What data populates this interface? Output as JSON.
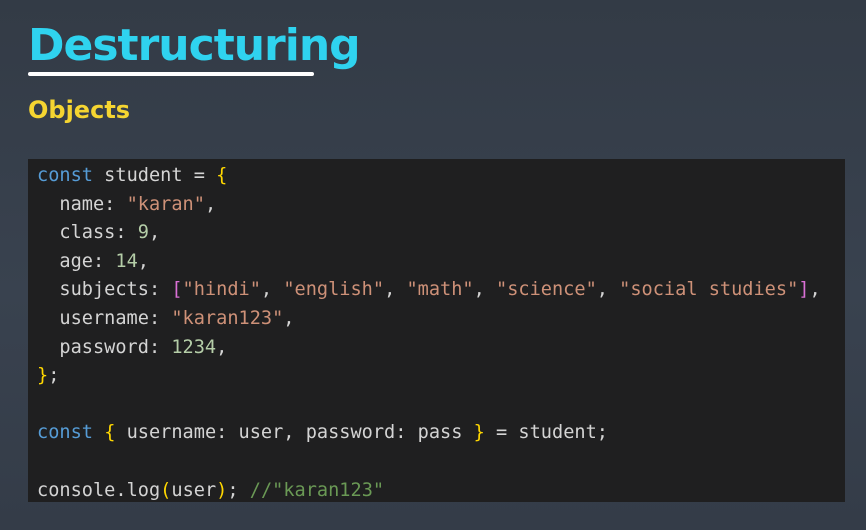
{
  "slide": {
    "title": "Destructuring",
    "subtitle": "Objects"
  },
  "colors": {
    "background": "#363f4b",
    "title": "#2fd3ef",
    "underline": "#ffffff",
    "subtitle": "#f5d531",
    "code_background": "#1f1f20",
    "keyword": "#569cd6",
    "string": "#ce9178",
    "number": "#b5cea8",
    "comment": "#6a9955",
    "bracket_level1": "#ffd700",
    "bracket_level2": "#da70d6"
  },
  "code": {
    "language": "javascript",
    "lines": [
      [
        {
          "t": "kw",
          "v": "const"
        },
        {
          "t": "id",
          "v": " student "
        },
        {
          "t": "pun",
          "v": "= "
        },
        {
          "t": "br1",
          "v": "{"
        }
      ],
      [
        {
          "t": "prop",
          "v": "  name"
        },
        {
          "t": "pun",
          "v": ": "
        },
        {
          "t": "str",
          "v": "\"karan\""
        },
        {
          "t": "pun",
          "v": ","
        }
      ],
      [
        {
          "t": "prop",
          "v": "  class"
        },
        {
          "t": "pun",
          "v": ": "
        },
        {
          "t": "num",
          "v": "9"
        },
        {
          "t": "pun",
          "v": ","
        }
      ],
      [
        {
          "t": "prop",
          "v": "  age"
        },
        {
          "t": "pun",
          "v": ": "
        },
        {
          "t": "num",
          "v": "14"
        },
        {
          "t": "pun",
          "v": ","
        }
      ],
      [
        {
          "t": "prop",
          "v": "  subjects"
        },
        {
          "t": "pun",
          "v": ": "
        },
        {
          "t": "br2",
          "v": "["
        },
        {
          "t": "str",
          "v": "\"hindi\""
        },
        {
          "t": "pun",
          "v": ", "
        },
        {
          "t": "str",
          "v": "\"english\""
        },
        {
          "t": "pun",
          "v": ", "
        },
        {
          "t": "str",
          "v": "\"math\""
        },
        {
          "t": "pun",
          "v": ", "
        },
        {
          "t": "str",
          "v": "\"science\""
        },
        {
          "t": "pun",
          "v": ", "
        },
        {
          "t": "str",
          "v": "\"social studies\""
        },
        {
          "t": "br2",
          "v": "]"
        },
        {
          "t": "pun",
          "v": ","
        }
      ],
      [
        {
          "t": "prop",
          "v": "  username"
        },
        {
          "t": "pun",
          "v": ": "
        },
        {
          "t": "str",
          "v": "\"karan123\""
        },
        {
          "t": "pun",
          "v": ","
        }
      ],
      [
        {
          "t": "prop",
          "v": "  password"
        },
        {
          "t": "pun",
          "v": ": "
        },
        {
          "t": "num",
          "v": "1234"
        },
        {
          "t": "pun",
          "v": ","
        }
      ],
      [
        {
          "t": "br1",
          "v": "}"
        },
        {
          "t": "pun",
          "v": ";"
        }
      ],
      [],
      [
        {
          "t": "kw",
          "v": "const"
        },
        {
          "t": "pun",
          "v": " "
        },
        {
          "t": "br1",
          "v": "{"
        },
        {
          "t": "id",
          "v": " username: user, password: pass "
        },
        {
          "t": "br1",
          "v": "}"
        },
        {
          "t": "pun",
          "v": " = "
        },
        {
          "t": "id",
          "v": "student"
        },
        {
          "t": "pun",
          "v": ";"
        }
      ],
      [],
      [
        {
          "t": "id",
          "v": "console"
        },
        {
          "t": "pun",
          "v": "."
        },
        {
          "t": "fn",
          "v": "log"
        },
        {
          "t": "br1",
          "v": "("
        },
        {
          "t": "id",
          "v": "user"
        },
        {
          "t": "br1",
          "v": ")"
        },
        {
          "t": "pun",
          "v": "; "
        },
        {
          "t": "cmt",
          "v": "//\"karan123\""
        }
      ]
    ]
  }
}
